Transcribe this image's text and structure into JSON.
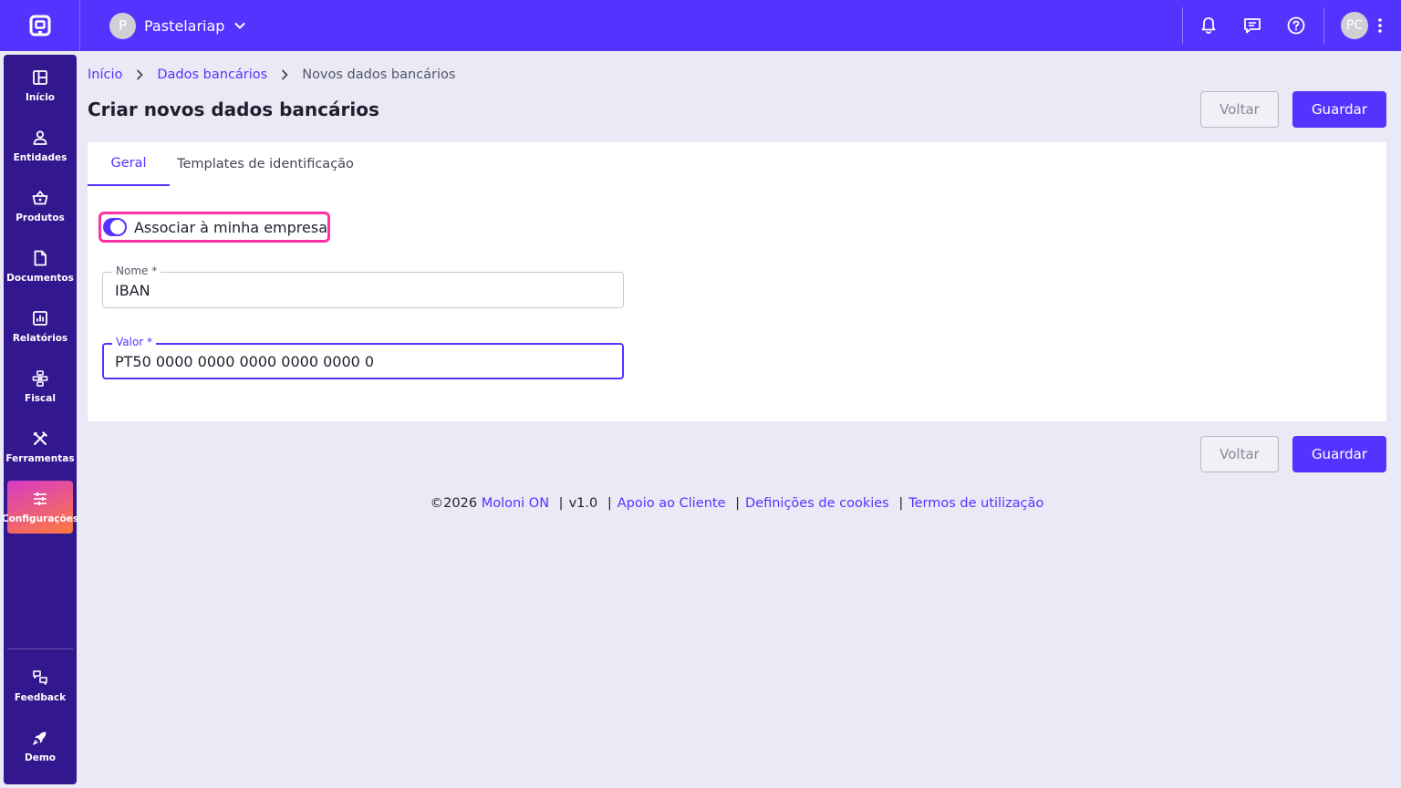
{
  "topbar": {
    "company_initial": "P",
    "company_name": "Pastelariap",
    "user_initials": "PC",
    "icons": [
      "app-logo-icon",
      "bell-icon",
      "chat-icon",
      "help-icon",
      "more-vertical-icon"
    ],
    "brand_color": "#5533ff"
  },
  "sidebar": {
    "items": [
      {
        "label": "Início",
        "icon": "dashboard-icon"
      },
      {
        "label": "Entidades",
        "icon": "person-icon"
      },
      {
        "label": "Produtos",
        "icon": "basket-icon"
      },
      {
        "label": "Documentos",
        "icon": "document-icon"
      },
      {
        "label": "Relatórios",
        "icon": "report-icon"
      },
      {
        "label": "Fiscal",
        "icon": "fiscal-icon"
      },
      {
        "label": "Ferramentas",
        "icon": "tools-icon"
      },
      {
        "label": "Configurações",
        "icon": "sliders-icon"
      }
    ],
    "bottom_items": [
      {
        "label": "Feedback",
        "icon": "feedback-icon"
      },
      {
        "label": "Demo",
        "icon": "rocket-icon"
      }
    ],
    "active_item": "Configurações",
    "background": "#33178f"
  },
  "breadcrumb": {
    "items": [
      "Início",
      "Dados bancários",
      "Novos dados bancários"
    ]
  },
  "page": {
    "title": "Criar novos dados bancários",
    "back_label": "Voltar",
    "save_label": "Guardar"
  },
  "tabs": {
    "general": "Geral",
    "templates": "Templates de identificação",
    "active": "Geral"
  },
  "form": {
    "toggle_label": "Associar à minha empresa",
    "toggle_on": true,
    "name_label": "Nome *",
    "name_value": "IBAN",
    "value_label": "Valor *",
    "value_value": "PT50 0000 0000 0000 0000 0000 0"
  },
  "footer": {
    "copyright": "©2026",
    "brand": "Moloni ON",
    "version": "v1.0",
    "support": "Apoio ao Cliente",
    "cookies": "Definições de cookies",
    "terms": "Termos de utilização",
    "separator": "|"
  }
}
